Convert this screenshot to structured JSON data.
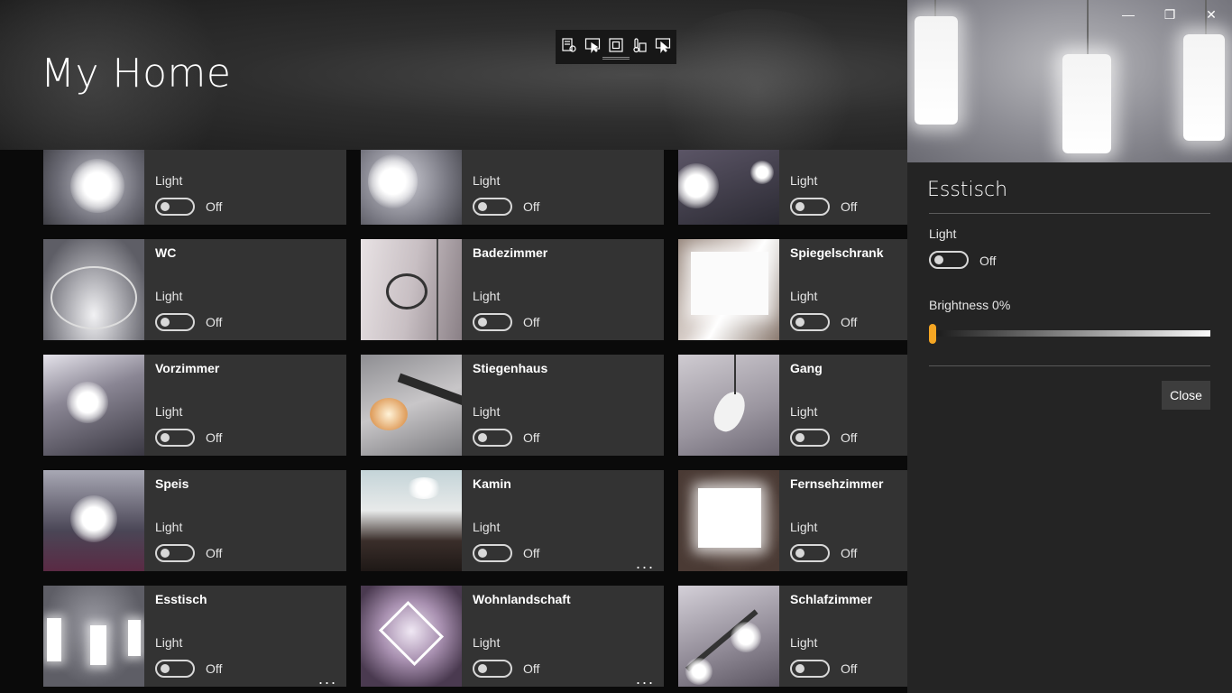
{
  "app": {
    "title": "My Home",
    "toolbar_icons": [
      "settings-list-icon",
      "select-pointer-icon",
      "frame-icon",
      "temperature-icon",
      "display-pointer-icon"
    ]
  },
  "window": {
    "minimize": "—",
    "maximize": "❐",
    "close": "✕"
  },
  "grid": {
    "light_label": "Light",
    "off_label": "Off",
    "more_label": "...",
    "tiles": [
      {
        "name": "",
        "state": "Off",
        "more": false
      },
      {
        "name": "",
        "state": "Off",
        "more": false
      },
      {
        "name": "",
        "state": "Off",
        "more": false
      },
      {
        "name": "WC",
        "state": "Off",
        "more": false
      },
      {
        "name": "Badezimmer",
        "state": "Off",
        "more": false
      },
      {
        "name": "Spiegelschrank",
        "state": "Off",
        "more": false
      },
      {
        "name": "Vorzimmer",
        "state": "Off",
        "more": false
      },
      {
        "name": "Stiegenhaus",
        "state": "Off",
        "more": false
      },
      {
        "name": "Gang",
        "state": "Off",
        "more": false
      },
      {
        "name": "Speis",
        "state": "Off",
        "more": false
      },
      {
        "name": "Kamin",
        "state": "Off",
        "more": true
      },
      {
        "name": "Fernsehzimmer",
        "state": "Off",
        "more": false
      },
      {
        "name": "Esstisch",
        "state": "Off",
        "more": true
      },
      {
        "name": "Wohnlandschaft",
        "state": "Off",
        "more": true
      },
      {
        "name": "Schlafzimmer",
        "state": "Off",
        "more": false
      }
    ]
  },
  "detail": {
    "title": "Esstisch",
    "light_label": "Light",
    "light_state": "Off",
    "brightness_label": "Brightness 0%",
    "brightness_value": 0,
    "close_label": "Close"
  }
}
